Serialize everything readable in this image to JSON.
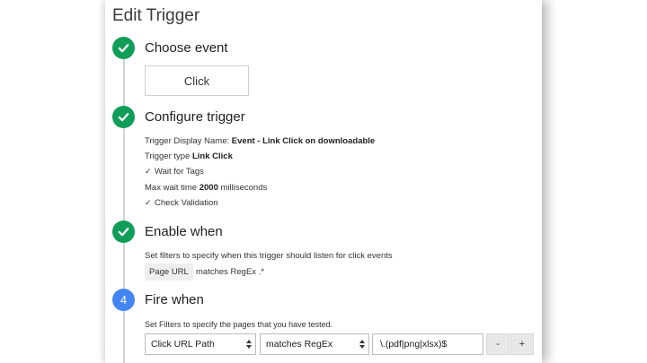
{
  "page": {
    "title": "Edit Trigger"
  },
  "steps": {
    "choose_event": {
      "title": "Choose event",
      "button_label": "Click"
    },
    "configure": {
      "title": "Configure trigger",
      "display_name_label": "Trigger Display Name:",
      "display_name_value": "Event - Link Click on downloadable",
      "type_label": "Trigger type",
      "type_value": "Link Click",
      "wait_for_tags": "Wait for Tags",
      "max_wait_prefix": "Max wait time",
      "max_wait_value": "2000",
      "max_wait_suffix": "milliseconds",
      "check_validation": "Check Validation"
    },
    "enable_when": {
      "title": "Enable when",
      "description": "Set filters to specify when this trigger should listen for click events",
      "variable": "Page URL",
      "condition": "matches RegEx .*"
    },
    "fire_when": {
      "number": "4",
      "title": "Fire when",
      "description": "Set Filters to specify the pages that you have tested.",
      "variable_select": "Click URL Path",
      "operator_select": "matches RegEx",
      "value_input": "\\.(pdf|png|xlsx)$",
      "remove_label": "-",
      "add_label": "+"
    }
  },
  "colors": {
    "done": "#0f9d58",
    "active": "#4285f4"
  },
  "icons": {
    "done": "check-icon",
    "select": "select-arrows-icon"
  }
}
